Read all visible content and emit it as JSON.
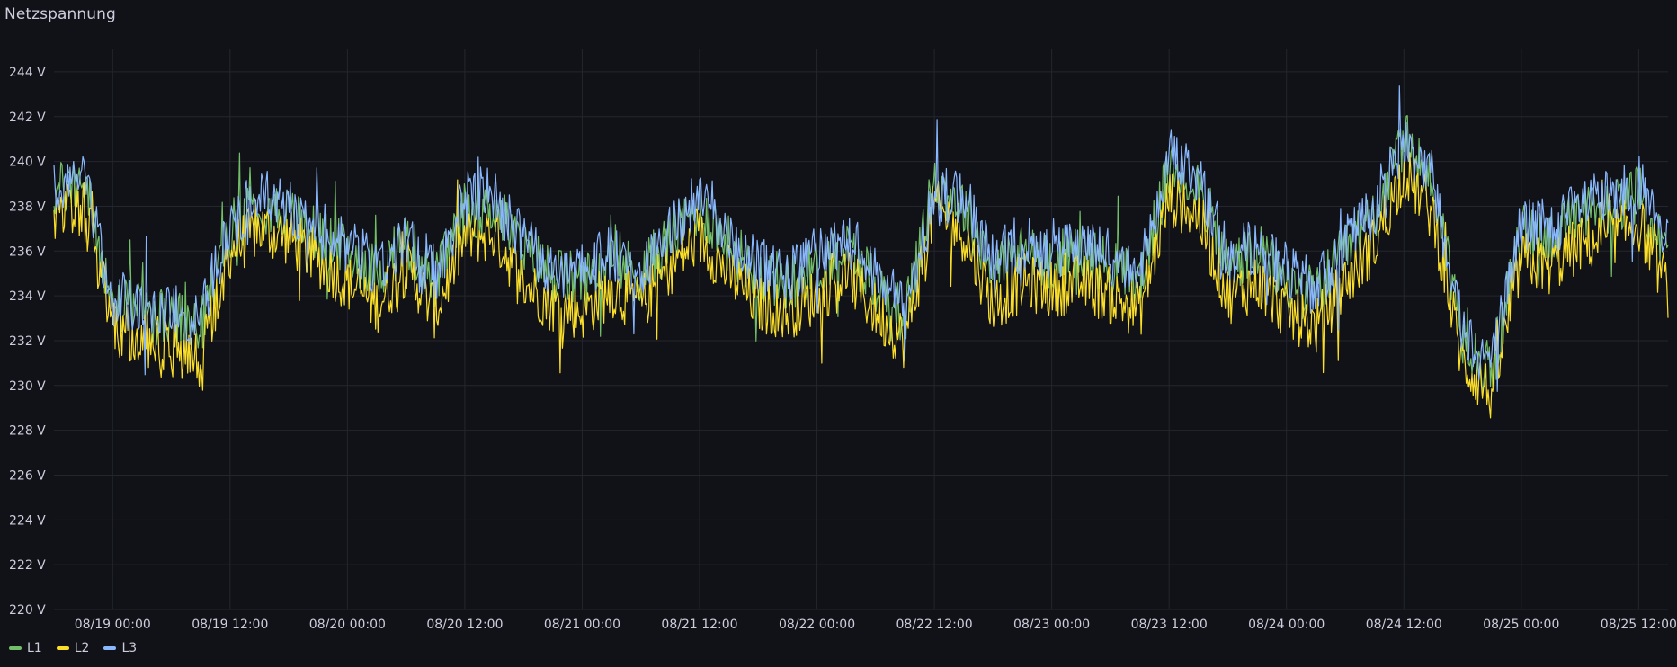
{
  "panel": {
    "title": "Netzspannung"
  },
  "chart_data": {
    "type": "line",
    "title": "Netzspannung",
    "unit": "V",
    "ylim": [
      220,
      245
    ],
    "y_ticks": [
      {
        "value": 220,
        "label": "220 V"
      },
      {
        "value": 222,
        "label": "222 V"
      },
      {
        "value": 224,
        "label": "224 V"
      },
      {
        "value": 226,
        "label": "226 V"
      },
      {
        "value": 228,
        "label": "228 V"
      },
      {
        "value": 230,
        "label": "230 V"
      },
      {
        "value": 232,
        "label": "232 V"
      },
      {
        "value": 234,
        "label": "234 V"
      },
      {
        "value": 236,
        "label": "236 V"
      },
      {
        "value": 238,
        "label": "238 V"
      },
      {
        "value": 240,
        "label": "240 V"
      },
      {
        "value": 242,
        "label": "242 V"
      },
      {
        "value": 244,
        "label": "244 V"
      }
    ],
    "x_range": [
      "08/18 18:00",
      "08/25 15:00"
    ],
    "x_ticks": [
      "08/19 00:00",
      "08/19 12:00",
      "08/20 00:00",
      "08/20 12:00",
      "08/21 00:00",
      "08/21 12:00",
      "08/22 00:00",
      "08/22 12:00",
      "08/23 00:00",
      "08/23 12:00",
      "08/24 00:00",
      "08/24 12:00",
      "08/25 00:00",
      "08/25 12:00"
    ],
    "grid": true,
    "legend_position": "bottom-left",
    "x": [
      "08/18 18:00",
      "08/18 21:00",
      "08/19 00:00",
      "08/19 03:00",
      "08/19 06:00",
      "08/19 09:00",
      "08/19 12:00",
      "08/19 15:00",
      "08/19 18:00",
      "08/19 21:00",
      "08/20 00:00",
      "08/20 03:00",
      "08/20 06:00",
      "08/20 09:00",
      "08/20 12:00",
      "08/20 15:00",
      "08/20 18:00",
      "08/20 21:00",
      "08/21 00:00",
      "08/21 03:00",
      "08/21 06:00",
      "08/21 09:00",
      "08/21 12:00",
      "08/21 15:00",
      "08/21 18:00",
      "08/21 21:00",
      "08/22 00:00",
      "08/22 03:00",
      "08/22 06:00",
      "08/22 09:00",
      "08/22 12:00",
      "08/22 15:00",
      "08/22 18:00",
      "08/22 21:00",
      "08/23 00:00",
      "08/23 03:00",
      "08/23 06:00",
      "08/23 09:00",
      "08/23 12:00",
      "08/23 15:00",
      "08/23 18:00",
      "08/23 21:00",
      "08/24 00:00",
      "08/24 03:00",
      "08/24 06:00",
      "08/24 09:00",
      "08/24 12:00",
      "08/24 15:00",
      "08/24 18:00",
      "08/24 21:00",
      "08/25 00:00",
      "08/25 03:00",
      "08/25 06:00",
      "08/25 09:00",
      "08/25 12:00",
      "08/25 15:00"
    ],
    "series": [
      {
        "name": "L1",
        "color": "#73bf69",
        "values": [
          238.6,
          239.2,
          233.6,
          233.3,
          232.9,
          232.6,
          237.0,
          238.2,
          237.6,
          236.6,
          236.0,
          235.0,
          236.5,
          234.6,
          237.8,
          238.0,
          236.0,
          235.0,
          234.6,
          235.6,
          235.0,
          236.6,
          238.0,
          236.3,
          235.0,
          234.6,
          235.3,
          236.2,
          234.6,
          233.0,
          239.0,
          238.0,
          235.3,
          235.9,
          235.6,
          236.0,
          235.3,
          234.6,
          239.6,
          239.0,
          235.3,
          236.0,
          234.6,
          234.0,
          236.0,
          237.6,
          241.0,
          239.0,
          232.3,
          230.6,
          236.8,
          236.6,
          237.6,
          237.9,
          238.6,
          235.6
        ]
      },
      {
        "name": "L2",
        "color": "#fade2a",
        "values": [
          237.6,
          238.0,
          232.6,
          232.2,
          231.6,
          231.2,
          236.0,
          237.0,
          236.6,
          235.6,
          234.6,
          233.6,
          235.3,
          233.3,
          236.6,
          236.8,
          234.6,
          233.6,
          233.3,
          234.3,
          233.6,
          235.3,
          236.6,
          235.0,
          233.6,
          233.3,
          234.0,
          235.0,
          233.3,
          232.0,
          238.0,
          236.8,
          233.6,
          234.6,
          234.3,
          234.6,
          234.0,
          233.3,
          238.4,
          237.6,
          234.0,
          234.6,
          233.3,
          232.6,
          234.6,
          236.3,
          239.6,
          237.6,
          231.0,
          229.6,
          235.6,
          235.3,
          236.3,
          236.6,
          237.3,
          234.3
        ]
      },
      {
        "name": "L3",
        "color": "#8ab8ff",
        "values": [
          238.8,
          239.4,
          233.8,
          233.6,
          233.3,
          233.0,
          237.3,
          238.4,
          237.9,
          237.0,
          236.3,
          235.3,
          236.8,
          235.0,
          238.3,
          238.6,
          236.3,
          235.3,
          235.0,
          236.0,
          235.3,
          236.9,
          238.6,
          236.6,
          235.3,
          235.0,
          235.6,
          236.6,
          235.0,
          233.3,
          238.6,
          238.3,
          235.6,
          236.3,
          235.9,
          236.3,
          235.6,
          235.0,
          240.3,
          239.3,
          235.6,
          236.3,
          235.0,
          234.3,
          236.3,
          238.0,
          241.0,
          239.3,
          232.6,
          231.0,
          237.3,
          236.9,
          238.0,
          238.3,
          239.0,
          236.0
        ]
      }
    ]
  }
}
